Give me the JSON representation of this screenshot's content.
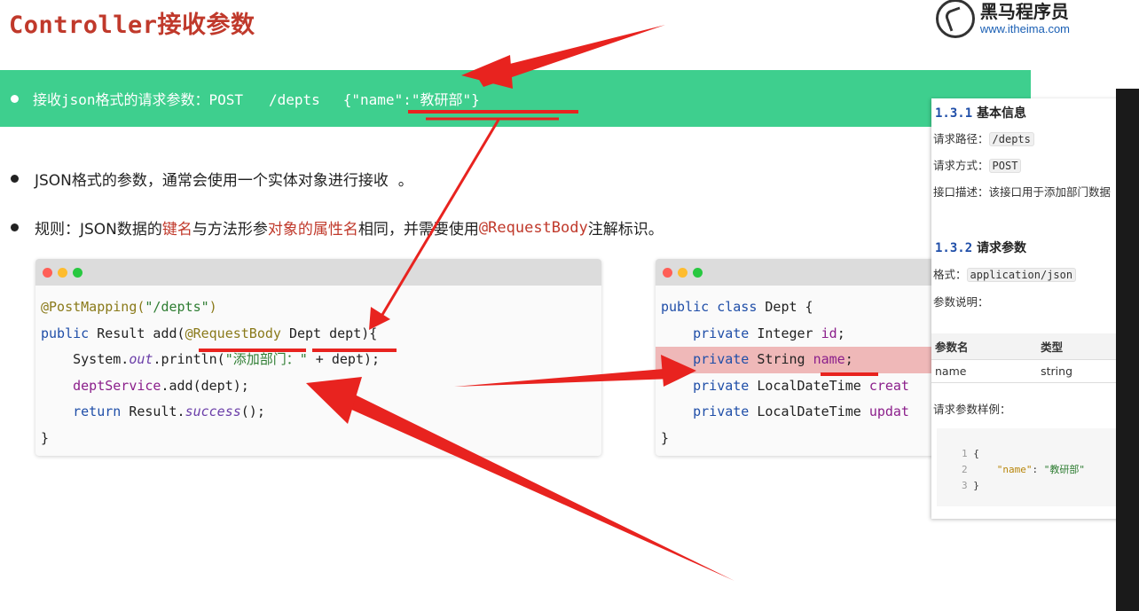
{
  "slide": {
    "title": "Controller接收参数",
    "logo": {
      "cn": "黑马程序员",
      "url": "www.itheima.com"
    }
  },
  "banner": {
    "text": "接收json格式的请求参数：POST   /depts",
    "json": "{\"name\":\"教研部\"}"
  },
  "bullets": {
    "b1": "JSON格式的参数，通常会使用一个实体对象进行接收  。",
    "b2_prefix": "规则：JSON数据的",
    "b2_key": "键名",
    "b2_mid": "与方法形参",
    "b2_attr": "对象的属性名",
    "b2_mid2": "相同，并需要使用",
    "b2_ann": "@RequestBody",
    "b2_suffix": "注解标识。"
  },
  "code_left": {
    "l1_ann": "@PostMapping(",
    "l1_str": "\"/depts\"",
    "l1_end": ")",
    "l2_kw": "public",
    "l2_a": " Result add(",
    "l2_ann": "@RequestBody",
    "l2_b": " Dept dept){",
    "l3_a": "    System.",
    "l3_it": "out",
    "l3_b": ".println(",
    "l3_str": "\"添加部门：\"",
    "l3_c": " + dept);",
    "l4_a": "    ",
    "l4_rp": "deptService",
    "l4_b": ".add(dept);",
    "l5_kw": "    return",
    "l5_a": " Result.",
    "l5_it": "success",
    "l5_b": "();",
    "l6": "}"
  },
  "code_right": {
    "l1_kw": "public class",
    "l1_a": " Dept {",
    "l2_kw": "    private",
    "l2_a": " Integer ",
    "l2_rp": "id",
    "l2_b": ";",
    "l3_kw": "    private",
    "l3_a": " String ",
    "l3_rp": "name",
    "l3_b": ";",
    "l4_kw": "    private",
    "l4_a": " LocalDateTime ",
    "l4_rp": "creat",
    "l5_kw": "    private",
    "l5_a": " LocalDateTime ",
    "l5_rp": "updat",
    "l6": "}"
  },
  "doc": {
    "s1_num": "1.3.1",
    "s1_title": " 基本信息",
    "path_label": "请求路径：",
    "path_val": "/depts",
    "method_label": "请求方式：",
    "method_val": "POST",
    "desc": "接口描述：该接口用于添加部门数据",
    "s2_num": "1.3.2",
    "s2_title": " 请求参数",
    "format_label": "格式：",
    "format_val": "application/json",
    "param_desc": "参数说明：",
    "table_headers": [
      "参数名",
      "类型"
    ],
    "table_row": [
      "name",
      "string"
    ],
    "sample_label": "请求参数样例：",
    "sample_l1n": "1",
    "sample_l1": " {",
    "sample_l2n": "2",
    "sample_l2k": "\"name\"",
    "sample_l2c": ": ",
    "sample_l2v": "\"教研部\"",
    "sample_l3n": "3",
    "sample_l3": " }"
  },
  "colors": {
    "banner": "#3ecf8e",
    "title": "#c0392b",
    "arrow": "#e8231f"
  }
}
